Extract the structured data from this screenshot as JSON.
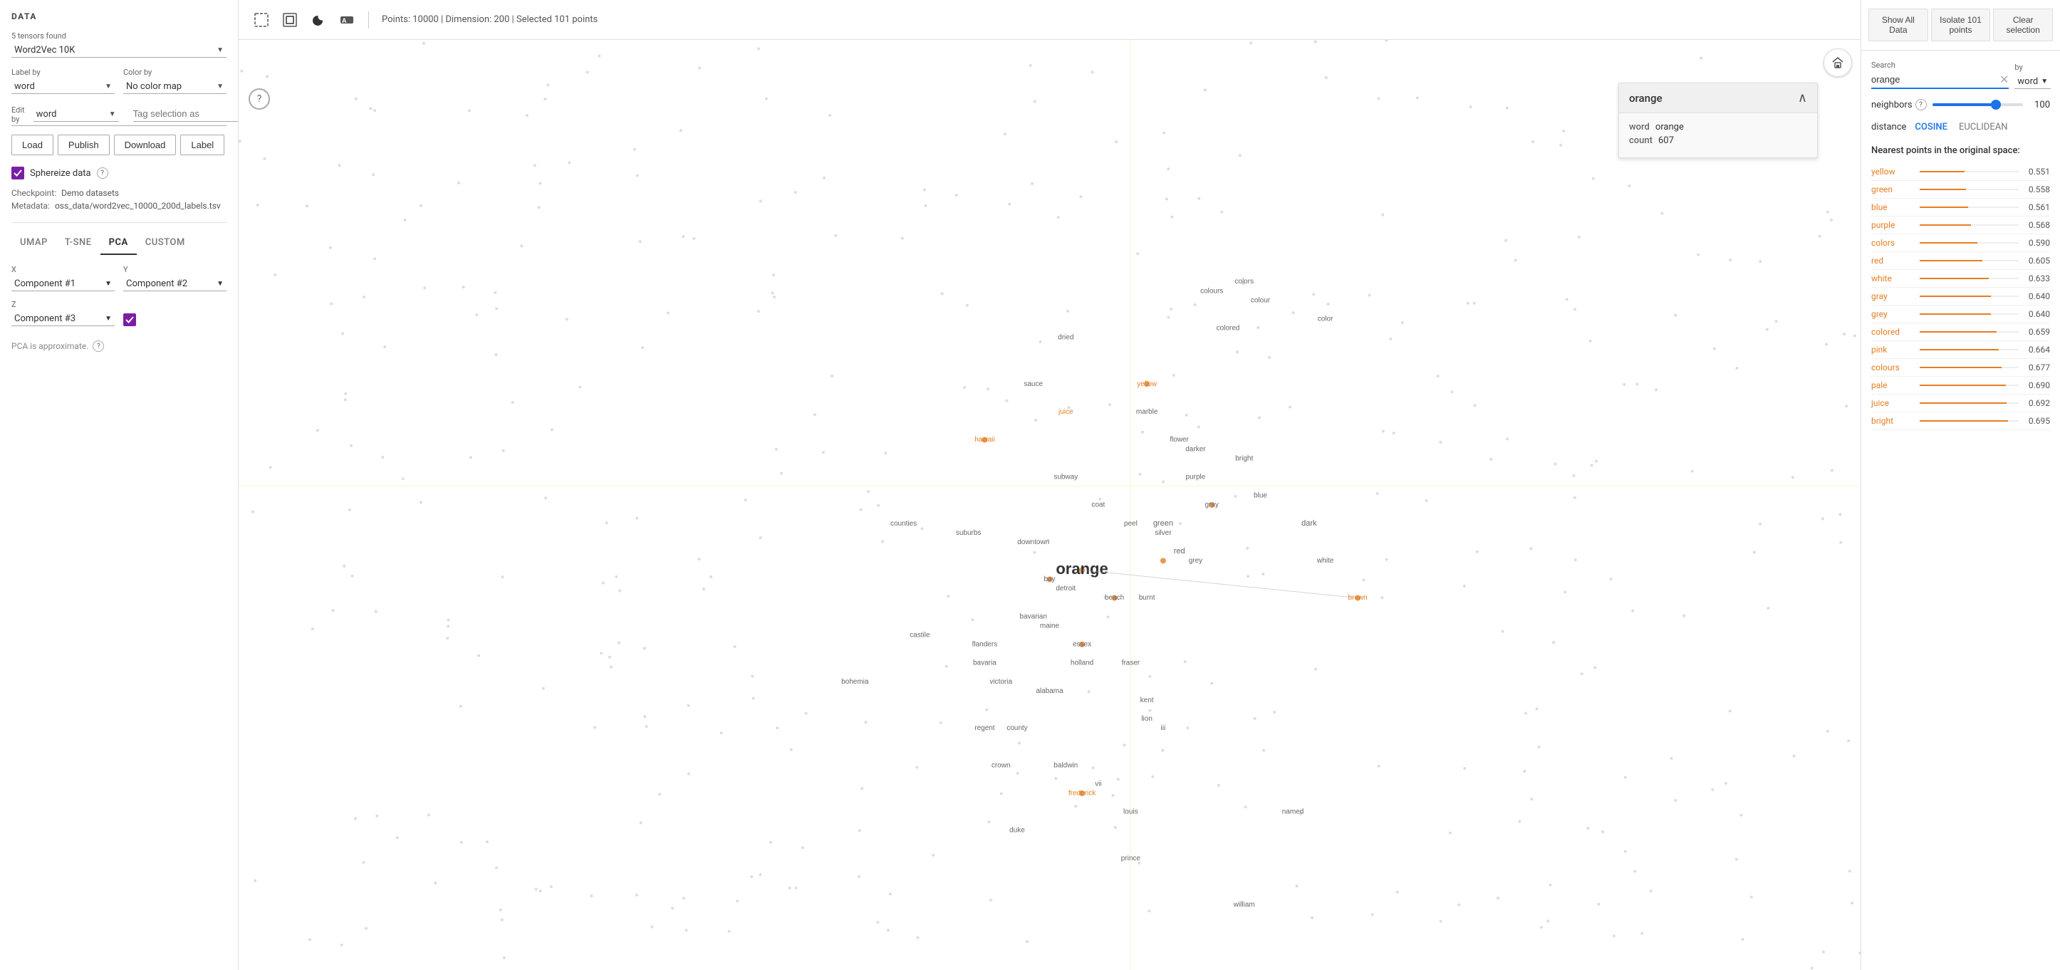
{
  "left": {
    "title": "DATA",
    "tensors_found": "5 tensors found",
    "dataset_label": "Word2Vec 10K",
    "label_by_label": "Label by",
    "label_by_value": "word",
    "color_by_label": "Color by",
    "color_by_value": "No color map",
    "edit_by_label": "Edit by",
    "edit_by_value": "word",
    "tag_selection_label": "Tag selection as",
    "buttons": {
      "load": "Load",
      "publish": "Publish",
      "download": "Download",
      "label": "Label"
    },
    "sphereize_label": "Sphereize data",
    "checkpoint_label": "Checkpoint:",
    "checkpoint_value": "Demo datasets",
    "metadata_label": "Metadata:",
    "metadata_value": "oss_data/word2vec_10000_200d_labels.tsv",
    "tabs": [
      "UMAP",
      "T-SNE",
      "PCA",
      "CUSTOM"
    ],
    "active_tab": "PCA",
    "x_label": "X",
    "x_value": "Component #1",
    "y_label": "Y",
    "y_value": "Component #2",
    "z_label": "Z",
    "z_value": "Component #3",
    "pca_note": "PCA is approximate."
  },
  "toolbar": {
    "points_info": "Points: 10000 | Dimension: 200 | Selected 101 points"
  },
  "popup": {
    "title": "orange",
    "word_label": "word",
    "word_value": "orange",
    "count_label": "count",
    "count_value": "607"
  },
  "right": {
    "show_all_label": "Show All Data",
    "isolate_label": "Isolate 101 points",
    "clear_label": "Clear selection",
    "search_label": "Search",
    "search_value": "orange",
    "by_label": "by",
    "by_value": "word",
    "neighbors_label": "neighbors",
    "neighbors_value": "100",
    "slider_pct": 70,
    "distance_label": "distance",
    "distance_options": [
      "COSINE",
      "EUCLIDEAN"
    ],
    "active_distance": "COSINE",
    "nearest_title": "Nearest points in the original space:",
    "nearest_items": [
      {
        "word": "yellow",
        "score": "0.551",
        "bar_pct": 45
      },
      {
        "word": "green",
        "score": "0.558",
        "bar_pct": 47
      },
      {
        "word": "blue",
        "score": "0.561",
        "bar_pct": 49
      },
      {
        "word": "purple",
        "score": "0.568",
        "bar_pct": 52
      },
      {
        "word": "colors",
        "score": "0.590",
        "bar_pct": 58
      },
      {
        "word": "red",
        "score": "0.605",
        "bar_pct": 63
      },
      {
        "word": "white",
        "score": "0.633",
        "bar_pct": 70
      },
      {
        "word": "gray",
        "score": "0.640",
        "bar_pct": 72
      },
      {
        "word": "grey",
        "score": "0.640",
        "bar_pct": 72
      },
      {
        "word": "colored",
        "score": "0.659",
        "bar_pct": 78
      },
      {
        "word": "pink",
        "score": "0.664",
        "bar_pct": 80
      },
      {
        "word": "colours",
        "score": "0.677",
        "bar_pct": 83
      },
      {
        "word": "pale",
        "score": "0.690",
        "bar_pct": 87
      },
      {
        "word": "juice",
        "score": "0.692",
        "bar_pct": 88
      },
      {
        "word": "bright",
        "score": "0.695",
        "bar_pct": 89
      }
    ]
  },
  "scatter": {
    "words": [
      {
        "text": "orange",
        "x": 52,
        "y": 57,
        "size": 22,
        "bold": true,
        "color": "#333"
      },
      {
        "text": "red",
        "x": 58,
        "y": 55,
        "size": 11,
        "bold": false,
        "color": "#666"
      },
      {
        "text": "green",
        "x": 57,
        "y": 52,
        "size": 11,
        "bold": false,
        "color": "#666"
      },
      {
        "text": "dark",
        "x": 66,
        "y": 52,
        "size": 11,
        "bold": false,
        "color": "#666"
      },
      {
        "text": "blue",
        "x": 63,
        "y": 49,
        "size": 10,
        "bold": false,
        "color": "#666"
      },
      {
        "text": "gray",
        "x": 60,
        "y": 50,
        "size": 10,
        "bold": false,
        "color": "#666"
      },
      {
        "text": "grey",
        "x": 59,
        "y": 56,
        "size": 10,
        "bold": false,
        "color": "#666"
      },
      {
        "text": "white",
        "x": 67,
        "y": 56,
        "size": 10,
        "bold": false,
        "color": "#666"
      },
      {
        "text": "silver",
        "x": 57,
        "y": 53,
        "size": 10,
        "bold": false,
        "color": "#666"
      },
      {
        "text": "purple",
        "x": 59,
        "y": 47,
        "size": 10,
        "bold": false,
        "color": "#666"
      },
      {
        "text": "bright",
        "x": 62,
        "y": 45,
        "size": 10,
        "bold": false,
        "color": "#666"
      },
      {
        "text": "burnt",
        "x": 56,
        "y": 60,
        "size": 10,
        "bold": false,
        "color": "#666"
      },
      {
        "text": "peel",
        "x": 55,
        "y": 52,
        "size": 10,
        "bold": false,
        "color": "#666"
      },
      {
        "text": "beach",
        "x": 54,
        "y": 60,
        "size": 10,
        "bold": false,
        "color": "#666"
      },
      {
        "text": "coat",
        "x": 53,
        "y": 50,
        "size": 10,
        "bold": false,
        "color": "#666"
      },
      {
        "text": "bay",
        "x": 50,
        "y": 58,
        "size": 10,
        "bold": false,
        "color": "#666"
      },
      {
        "text": "colour",
        "x": 63,
        "y": 28,
        "size": 10,
        "bold": false,
        "color": "#666"
      },
      {
        "text": "color",
        "x": 67,
        "y": 30,
        "size": 10,
        "bold": false,
        "color": "#666"
      },
      {
        "text": "colors",
        "x": 62,
        "y": 26,
        "size": 10,
        "bold": false,
        "color": "#666"
      },
      {
        "text": "colours",
        "x": 60,
        "y": 27,
        "size": 10,
        "bold": false,
        "color": "#666"
      },
      {
        "text": "colored",
        "x": 61,
        "y": 31,
        "size": 10,
        "bold": false,
        "color": "#666"
      },
      {
        "text": "dried",
        "x": 51,
        "y": 32,
        "size": 10,
        "bold": false,
        "color": "#666"
      },
      {
        "text": "sauce",
        "x": 49,
        "y": 37,
        "size": 10,
        "bold": false,
        "color": "#666"
      },
      {
        "text": "juice",
        "x": 51,
        "y": 40,
        "size": 10,
        "bold": false,
        "color": "#e67e22"
      },
      {
        "text": "marble",
        "x": 56,
        "y": 40,
        "size": 10,
        "bold": false,
        "color": "#666"
      },
      {
        "text": "yellow",
        "x": 56,
        "y": 37,
        "size": 10,
        "bold": false,
        "color": "#e67e22"
      },
      {
        "text": "flower",
        "x": 58,
        "y": 43,
        "size": 10,
        "bold": false,
        "color": "#666"
      },
      {
        "text": "darker",
        "x": 59,
        "y": 44,
        "size": 10,
        "bold": false,
        "color": "#666"
      },
      {
        "text": "hawaii",
        "x": 46,
        "y": 43,
        "size": 10,
        "bold": false,
        "color": "#e67e22"
      },
      {
        "text": "subway",
        "x": 51,
        "y": 47,
        "size": 10,
        "bold": false,
        "color": "#666"
      },
      {
        "text": "suburbs",
        "x": 45,
        "y": 53,
        "size": 10,
        "bold": false,
        "color": "#666"
      },
      {
        "text": "downtown",
        "x": 49,
        "y": 54,
        "size": 10,
        "bold": false,
        "color": "#666"
      },
      {
        "text": "detroit",
        "x": 51,
        "y": 59,
        "size": 10,
        "bold": false,
        "color": "#666"
      },
      {
        "text": "essex",
        "x": 52,
        "y": 65,
        "size": 10,
        "bold": false,
        "color": "#666"
      },
      {
        "text": "bavarian",
        "x": 49,
        "y": 62,
        "size": 10,
        "bold": false,
        "color": "#666"
      },
      {
        "text": "maine",
        "x": 50,
        "y": 63,
        "size": 10,
        "bold": false,
        "color": "#666"
      },
      {
        "text": "holland",
        "x": 52,
        "y": 67,
        "size": 10,
        "bold": false,
        "color": "#666"
      },
      {
        "text": "fraser",
        "x": 55,
        "y": 67,
        "size": 10,
        "bold": false,
        "color": "#666"
      },
      {
        "text": "castile",
        "x": 42,
        "y": 64,
        "size": 10,
        "bold": false,
        "color": "#666"
      },
      {
        "text": "flanders",
        "x": 46,
        "y": 65,
        "size": 10,
        "bold": false,
        "color": "#666"
      },
      {
        "text": "bavaria",
        "x": 46,
        "y": 67,
        "size": 10,
        "bold": false,
        "color": "#666"
      },
      {
        "text": "victoria",
        "x": 47,
        "y": 69,
        "size": 10,
        "bold": false,
        "color": "#666"
      },
      {
        "text": "alabama",
        "x": 50,
        "y": 70,
        "size": 10,
        "bold": false,
        "color": "#666"
      },
      {
        "text": "kent",
        "x": 56,
        "y": 71,
        "size": 10,
        "bold": false,
        "color": "#666"
      },
      {
        "text": "lion",
        "x": 56,
        "y": 73,
        "size": 10,
        "bold": false,
        "color": "#666"
      },
      {
        "text": "iii",
        "x": 57,
        "y": 74,
        "size": 10,
        "bold": false,
        "color": "#666"
      },
      {
        "text": "county",
        "x": 48,
        "y": 74,
        "size": 10,
        "bold": false,
        "color": "#666"
      },
      {
        "text": "counties",
        "x": 41,
        "y": 52,
        "size": 10,
        "bold": false,
        "color": "#666"
      },
      {
        "text": "regent",
        "x": 46,
        "y": 74,
        "size": 10,
        "bold": false,
        "color": "#666"
      },
      {
        "text": "crown",
        "x": 47,
        "y": 78,
        "size": 10,
        "bold": false,
        "color": "#666"
      },
      {
        "text": "bohemia",
        "x": 38,
        "y": 69,
        "size": 10,
        "bold": false,
        "color": "#666"
      },
      {
        "text": "frederick",
        "x": 52,
        "y": 81,
        "size": 10,
        "bold": false,
        "color": "#e67e22"
      },
      {
        "text": "louis",
        "x": 55,
        "y": 83,
        "size": 10,
        "bold": false,
        "color": "#666"
      },
      {
        "text": "named",
        "x": 65,
        "y": 83,
        "size": 10,
        "bold": false,
        "color": "#666"
      },
      {
        "text": "duke",
        "x": 48,
        "y": 85,
        "size": 10,
        "bold": false,
        "color": "#666"
      },
      {
        "text": "prince",
        "x": 55,
        "y": 88,
        "size": 10,
        "bold": false,
        "color": "#666"
      },
      {
        "text": "william",
        "x": 62,
        "y": 93,
        "size": 10,
        "bold": false,
        "color": "#666"
      },
      {
        "text": "baldwin",
        "x": 51,
        "y": 78,
        "size": 10,
        "bold": false,
        "color": "#666"
      },
      {
        "text": "vii",
        "x": 53,
        "y": 80,
        "size": 10,
        "bold": false,
        "color": "#666"
      },
      {
        "text": "brown",
        "x": 69,
        "y": 60,
        "size": 10,
        "bold": false,
        "color": "#e67e22"
      }
    ]
  }
}
